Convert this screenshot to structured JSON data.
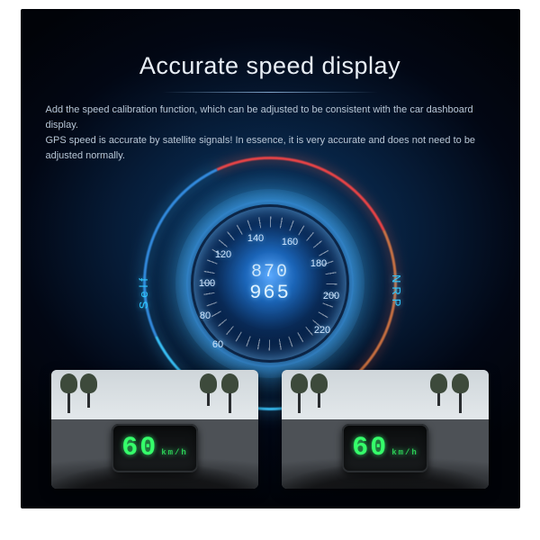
{
  "title": "Accurate speed display",
  "subtitle": "Add the speed calibration function, which can be adjusted to be consistent with the car dashboard display.\nGPS speed is accurate by satellite signals! In essence, it is very accurate and does not need to be adjusted normally.",
  "gauge": {
    "side_left_label": "Self",
    "side_right_label": "NRP",
    "center_line1": "870",
    "center_line2": "965",
    "dial_numbers": [
      "60",
      "80",
      "100",
      "120",
      "140",
      "160",
      "180",
      "200",
      "220"
    ]
  },
  "frames": [
    {
      "speed": "60",
      "unit": "km/h"
    },
    {
      "speed": "60",
      "unit": "km/h"
    }
  ]
}
